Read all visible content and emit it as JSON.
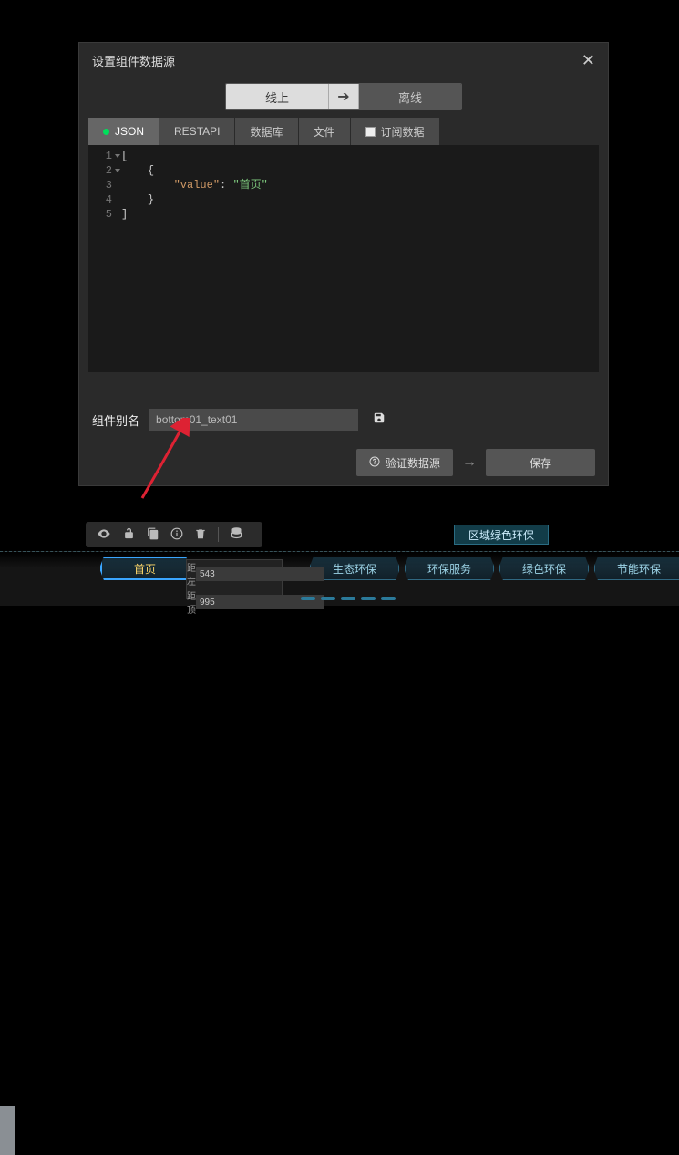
{
  "modal": {
    "title": "设置组件数据源",
    "segmented": {
      "online": "线上",
      "offline": "离线"
    },
    "tabs": {
      "json": "JSON",
      "restapi": "RESTAPI",
      "database": "数据库",
      "file": "文件",
      "subscribe": "订阅数据"
    },
    "alias_label": "组件别名",
    "alias_value": "bottom01_text01",
    "verify_label": "验证数据源",
    "save_label": "保存"
  },
  "code": {
    "line_numbers": [
      "1",
      "2",
      "3",
      "4",
      "5"
    ],
    "key": "\"value\"",
    "value": "\"首页\""
  },
  "title_banner": "区域绿色环保",
  "nav": {
    "items": [
      "首页",
      "生态环保",
      "环保服务",
      "绿色环保",
      "节能环保"
    ]
  },
  "pos": {
    "left_label": "距左",
    "left_value": "543",
    "top_label": "距顶",
    "top_value": "995"
  },
  "colors": {
    "accent_green": "#00e05b"
  }
}
